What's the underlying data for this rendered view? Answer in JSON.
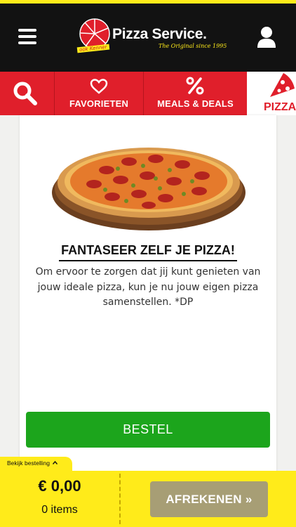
{
  "header": {
    "logo_text": "Pizza Service.",
    "logo_tagline": "The Original since 1995",
    "logo_badge": "ook Kenner",
    "menu_icon": "hamburger-menu-icon",
    "user_icon": "user-account-icon"
  },
  "nav": {
    "items": [
      {
        "label": "",
        "icon": "search-icon"
      },
      {
        "label": "FAVORIETEN",
        "icon": "heart-icon"
      },
      {
        "label": "MEALS & DEALS",
        "icon": "percent-icon"
      },
      {
        "label": "PIZZA",
        "icon": "pizza-slice-icon",
        "active": true
      }
    ],
    "colors": {
      "bar": "#e01f2b",
      "active_bg": "#ffffff"
    }
  },
  "product": {
    "title": "FANTASEER ZELF JE PIZZA!",
    "description": "Om ervoor te zorgen dat jij kunt genieten van jouw ideale pizza, kun je nu jouw eigen pizza samenstellen. *DP",
    "image": "pepperoni-pizza-on-wooden-board",
    "button_label": "BESTEL",
    "button_color": "#1ca51c"
  },
  "cart": {
    "view_order_label": "Bekijk bestelling",
    "total": "€ 0,00",
    "items_label": "0 items",
    "checkout_label": "AFREKENEN »",
    "footer_color": "#ffeb1a",
    "checkout_color": "#a79e75"
  }
}
